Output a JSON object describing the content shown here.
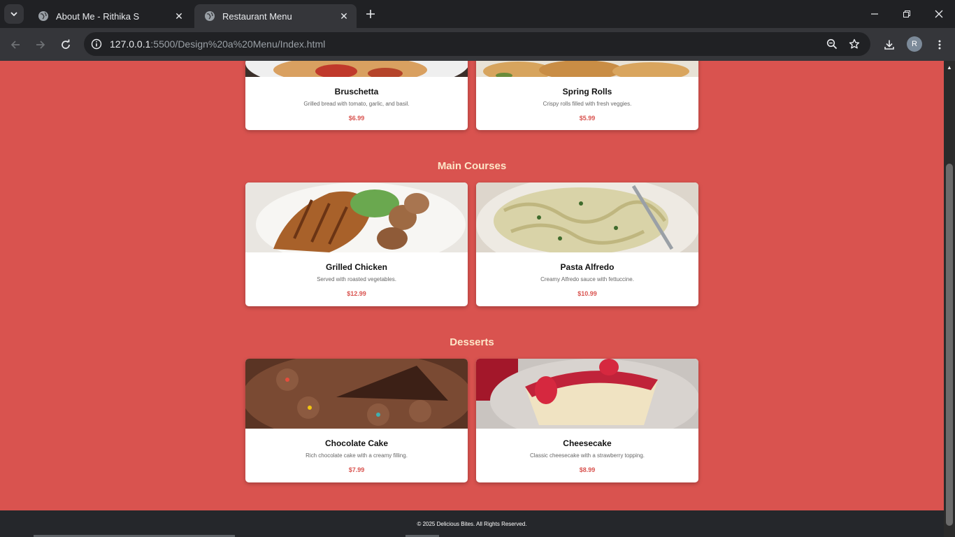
{
  "tabs": [
    {
      "title": "About Me - Rithika S",
      "active": false
    },
    {
      "title": "Restaurant Menu",
      "active": true
    }
  ],
  "address_bar": {
    "host": "127.0.0.1",
    "path": ":5500/Design%20a%20Menu/Index.html"
  },
  "profile_initial": "R",
  "sections": [
    {
      "title": "Main Courses"
    },
    {
      "title": "Desserts"
    }
  ],
  "items": {
    "bruschetta": {
      "name": "Bruschetta",
      "desc": "Grilled bread with tomato, garlic, and basil.",
      "price": "$6.99"
    },
    "spring_rolls": {
      "name": "Spring Rolls",
      "desc": "Crispy rolls filled with fresh veggies.",
      "price": "$5.99"
    },
    "grilled_chicken": {
      "name": "Grilled Chicken",
      "desc": "Served with roasted vegetables.",
      "price": "$12.99"
    },
    "pasta_alfredo": {
      "name": "Pasta Alfredo",
      "desc": "Creamy Alfredo sauce with fettuccine.",
      "price": "$10.99"
    },
    "chocolate_cake": {
      "name": "Chocolate Cake",
      "desc": "Rich chocolate cake with a creamy filling.",
      "price": "$7.99"
    },
    "cheesecake": {
      "name": "Cheesecake",
      "desc": "Classic cheesecake with a strawberry topping.",
      "price": "$8.99"
    }
  },
  "footer": "© 2025 Delicious Bites. All Rights Reserved.",
  "colors": {
    "page_bg": "#d9534f",
    "price": "#d9534f",
    "section_title": "#fde6c8",
    "footer_bg": "#25272b"
  }
}
